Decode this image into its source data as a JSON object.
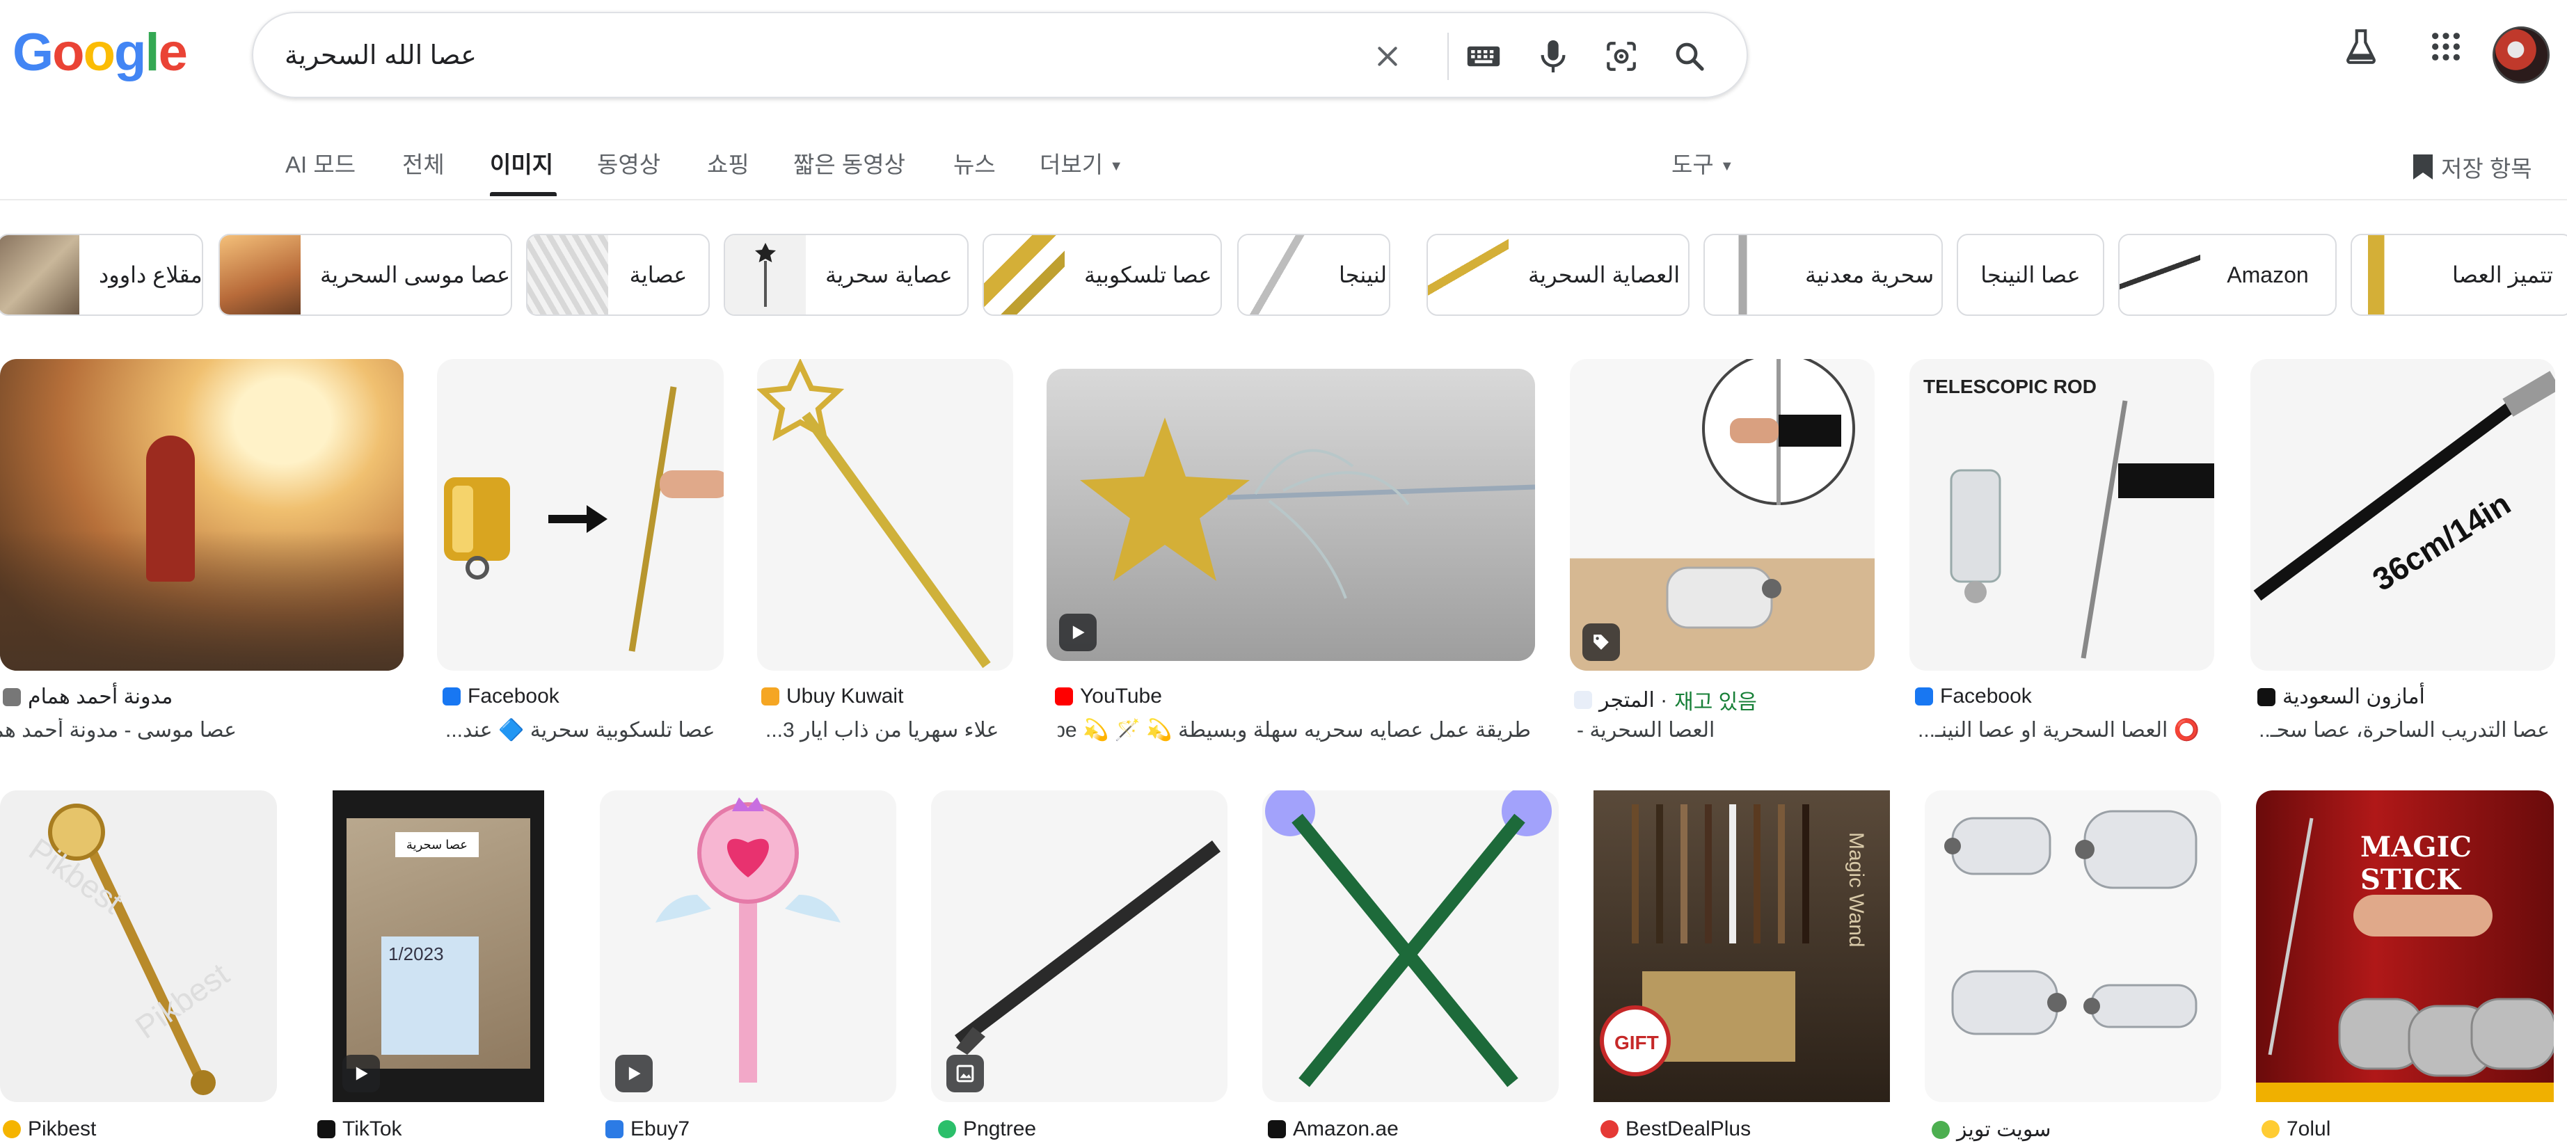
{
  "logo": "Google",
  "search": {
    "query": "عصا الله السحرية"
  },
  "tabs": [
    {
      "label": "AI 모드"
    },
    {
      "label": "전체"
    },
    {
      "label": "이미지",
      "active": true
    },
    {
      "label": "동영상"
    },
    {
      "label": "쇼핑"
    },
    {
      "label": "짧은 동영상"
    },
    {
      "label": "뉴스"
    },
    {
      "label": "더보기"
    }
  ],
  "tools_label": "도구",
  "saved_label": "저장 항목",
  "chips": [
    "مقلاع داوود",
    "عصا موسى السحرية",
    "عصاية",
    "عصاية سحرية",
    "عصا تلسكوبية",
    "النينجا",
    "العصاية السحرية",
    "سحرية معدنية",
    "عصا النينجا",
    "Amazon",
    "تتميز العصا"
  ],
  "row1": [
    {
      "source": "مدونة أحمد همام",
      "title": "عصا موسى - مدونة أحمد همام",
      "icon": "person-favicon"
    },
    {
      "source": "Facebook",
      "title": "عصا تلسكوبية سحرية 🔷 عند...",
      "icon": "facebook-favicon"
    },
    {
      "source": "Ubuy Kuwait",
      "title": "علاء سهريا من ذاب ايار 3...",
      "icon": "ubuy-favicon"
    },
    {
      "source": "YouTube",
      "title": "طريقة عمل عصايه سحريه سهلة وبسيطة 💫 🪄 💫 be...",
      "icon": "youtube-favicon"
    },
    {
      "source": "المتجر · ",
      "stock": "재고 있음",
      "title": "العصا السحرية -",
      "icon": "store-favicon"
    },
    {
      "source": "Facebook",
      "title": "⭕ العصا السحرية او عصا النينـ...",
      "icon": "facebook-favicon"
    },
    {
      "source": "أمازون السعودية",
      "title": "عصا التدريب الساحرة، عصا سحـ...",
      "icon": "amazon-favicon"
    }
  ],
  "row2": [
    {
      "source": "Pikbest",
      "icon": "pikbest-favicon"
    },
    {
      "source": "TikTok",
      "icon": "tiktok-favicon"
    },
    {
      "source": "Ebuy7",
      "icon": "ebuy-favicon"
    },
    {
      "source": "Pngtree",
      "icon": "pngtree-favicon"
    },
    {
      "source": "Amazon.ae",
      "icon": "amazon-favicon"
    },
    {
      "source": "BestDealPlus",
      "icon": "bestdeal-favicon"
    },
    {
      "source": "سويت تويز",
      "icon": "globe-favicon"
    },
    {
      "source": "7olul",
      "icon": "emoji-favicon"
    }
  ],
  "image_text": {
    "telescopic": "TELESCOPIC ROD",
    "size": "36cm/14in",
    "magic_stick": "MAGIC STICK",
    "magic_wand": "Magic Wand",
    "gift": "GIFT",
    "tiktok_note": "عصا سحرية",
    "tiktok_date": "1/2023",
    "pikbest_wm": "Pikbest"
  },
  "colors": {
    "accent_blue": "#1a73e8",
    "stock_green": "#188038",
    "text": "#202124",
    "muted": "#5f6368"
  }
}
